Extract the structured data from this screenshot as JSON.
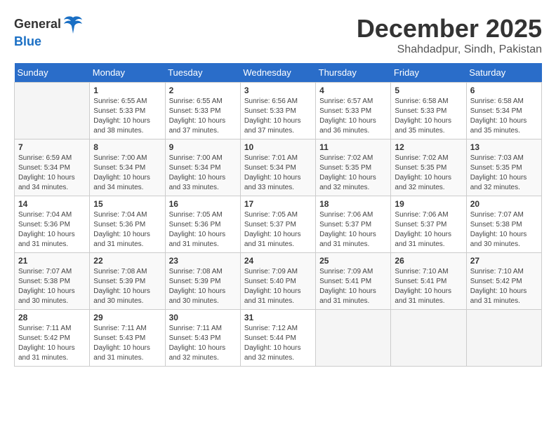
{
  "logo": {
    "text1": "General",
    "text2": "Blue"
  },
  "title": "December 2025",
  "location": "Shahdadpur, Sindh, Pakistan",
  "weekdays": [
    "Sunday",
    "Monday",
    "Tuesday",
    "Wednesday",
    "Thursday",
    "Friday",
    "Saturday"
  ],
  "weeks": [
    [
      {
        "day": "",
        "info": ""
      },
      {
        "day": "1",
        "info": "Sunrise: 6:55 AM\nSunset: 5:33 PM\nDaylight: 10 hours\nand 38 minutes."
      },
      {
        "day": "2",
        "info": "Sunrise: 6:55 AM\nSunset: 5:33 PM\nDaylight: 10 hours\nand 37 minutes."
      },
      {
        "day": "3",
        "info": "Sunrise: 6:56 AM\nSunset: 5:33 PM\nDaylight: 10 hours\nand 37 minutes."
      },
      {
        "day": "4",
        "info": "Sunrise: 6:57 AM\nSunset: 5:33 PM\nDaylight: 10 hours\nand 36 minutes."
      },
      {
        "day": "5",
        "info": "Sunrise: 6:58 AM\nSunset: 5:33 PM\nDaylight: 10 hours\nand 35 minutes."
      },
      {
        "day": "6",
        "info": "Sunrise: 6:58 AM\nSunset: 5:34 PM\nDaylight: 10 hours\nand 35 minutes."
      }
    ],
    [
      {
        "day": "7",
        "info": "Sunrise: 6:59 AM\nSunset: 5:34 PM\nDaylight: 10 hours\nand 34 minutes."
      },
      {
        "day": "8",
        "info": "Sunrise: 7:00 AM\nSunset: 5:34 PM\nDaylight: 10 hours\nand 34 minutes."
      },
      {
        "day": "9",
        "info": "Sunrise: 7:00 AM\nSunset: 5:34 PM\nDaylight: 10 hours\nand 33 minutes."
      },
      {
        "day": "10",
        "info": "Sunrise: 7:01 AM\nSunset: 5:34 PM\nDaylight: 10 hours\nand 33 minutes."
      },
      {
        "day": "11",
        "info": "Sunrise: 7:02 AM\nSunset: 5:35 PM\nDaylight: 10 hours\nand 32 minutes."
      },
      {
        "day": "12",
        "info": "Sunrise: 7:02 AM\nSunset: 5:35 PM\nDaylight: 10 hours\nand 32 minutes."
      },
      {
        "day": "13",
        "info": "Sunrise: 7:03 AM\nSunset: 5:35 PM\nDaylight: 10 hours\nand 32 minutes."
      }
    ],
    [
      {
        "day": "14",
        "info": "Sunrise: 7:04 AM\nSunset: 5:36 PM\nDaylight: 10 hours\nand 31 minutes."
      },
      {
        "day": "15",
        "info": "Sunrise: 7:04 AM\nSunset: 5:36 PM\nDaylight: 10 hours\nand 31 minutes."
      },
      {
        "day": "16",
        "info": "Sunrise: 7:05 AM\nSunset: 5:36 PM\nDaylight: 10 hours\nand 31 minutes."
      },
      {
        "day": "17",
        "info": "Sunrise: 7:05 AM\nSunset: 5:37 PM\nDaylight: 10 hours\nand 31 minutes."
      },
      {
        "day": "18",
        "info": "Sunrise: 7:06 AM\nSunset: 5:37 PM\nDaylight: 10 hours\nand 31 minutes."
      },
      {
        "day": "19",
        "info": "Sunrise: 7:06 AM\nSunset: 5:37 PM\nDaylight: 10 hours\nand 31 minutes."
      },
      {
        "day": "20",
        "info": "Sunrise: 7:07 AM\nSunset: 5:38 PM\nDaylight: 10 hours\nand 30 minutes."
      }
    ],
    [
      {
        "day": "21",
        "info": "Sunrise: 7:07 AM\nSunset: 5:38 PM\nDaylight: 10 hours\nand 30 minutes."
      },
      {
        "day": "22",
        "info": "Sunrise: 7:08 AM\nSunset: 5:39 PM\nDaylight: 10 hours\nand 30 minutes."
      },
      {
        "day": "23",
        "info": "Sunrise: 7:08 AM\nSunset: 5:39 PM\nDaylight: 10 hours\nand 30 minutes."
      },
      {
        "day": "24",
        "info": "Sunrise: 7:09 AM\nSunset: 5:40 PM\nDaylight: 10 hours\nand 31 minutes."
      },
      {
        "day": "25",
        "info": "Sunrise: 7:09 AM\nSunset: 5:41 PM\nDaylight: 10 hours\nand 31 minutes."
      },
      {
        "day": "26",
        "info": "Sunrise: 7:10 AM\nSunset: 5:41 PM\nDaylight: 10 hours\nand 31 minutes."
      },
      {
        "day": "27",
        "info": "Sunrise: 7:10 AM\nSunset: 5:42 PM\nDaylight: 10 hours\nand 31 minutes."
      }
    ],
    [
      {
        "day": "28",
        "info": "Sunrise: 7:11 AM\nSunset: 5:42 PM\nDaylight: 10 hours\nand 31 minutes."
      },
      {
        "day": "29",
        "info": "Sunrise: 7:11 AM\nSunset: 5:43 PM\nDaylight: 10 hours\nand 31 minutes."
      },
      {
        "day": "30",
        "info": "Sunrise: 7:11 AM\nSunset: 5:43 PM\nDaylight: 10 hours\nand 32 minutes."
      },
      {
        "day": "31",
        "info": "Sunrise: 7:12 AM\nSunset: 5:44 PM\nDaylight: 10 hours\nand 32 minutes."
      },
      {
        "day": "",
        "info": ""
      },
      {
        "day": "",
        "info": ""
      },
      {
        "day": "",
        "info": ""
      }
    ]
  ]
}
